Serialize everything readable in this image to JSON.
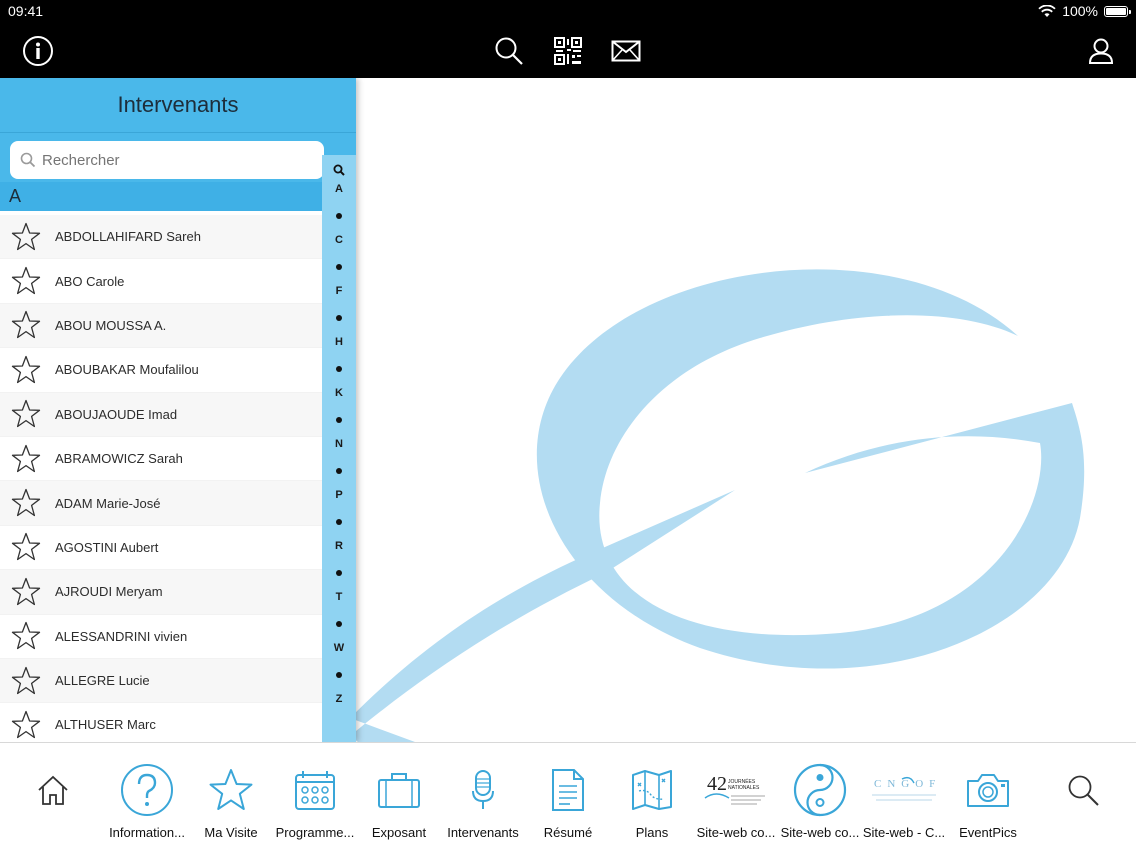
{
  "status_bar": {
    "time": "09:41",
    "battery": "100%"
  },
  "top_bar": {
    "icons": [
      "info-icon",
      "search-icon",
      "qr-code-icon",
      "mail-icon",
      "user-icon"
    ]
  },
  "panel": {
    "title": "Intervenants",
    "search_placeholder": "Rechercher",
    "section_letter": "A",
    "speakers": [
      "ABDOLLAHIFARD Sareh",
      "ABO Carole",
      "ABOU MOUSSA A.",
      "ABOUBAKAR Moufalilou",
      "ABOUJAOUDE Imad",
      "ABRAMOWICZ Sarah",
      "ADAM Marie-José",
      "AGOSTINI Aubert",
      "AJROUDI Meryam",
      "ALESSANDRINI vivien",
      "ALLEGRE Lucie",
      "ALTHUSER Marc"
    ],
    "index_letters": [
      "A",
      "C",
      "F",
      "H",
      "K",
      "N",
      "P",
      "R",
      "T",
      "W",
      "Z"
    ]
  },
  "tabbar": {
    "tabs": [
      {
        "label": "",
        "icon": "home-icon"
      },
      {
        "label": "Information...",
        "icon": "question-icon"
      },
      {
        "label": "Ma Visite",
        "icon": "star-icon"
      },
      {
        "label": "Programme...",
        "icon": "calendar-icon"
      },
      {
        "label": "Exposant",
        "icon": "briefcase-icon"
      },
      {
        "label": "Intervenants",
        "icon": "microphone-icon"
      },
      {
        "label": "Résumé",
        "icon": "document-icon"
      },
      {
        "label": "Plans",
        "icon": "map-icon"
      },
      {
        "label": "Site-web co...",
        "icon": "journees-logo-icon"
      },
      {
        "label": "Site-web co...",
        "icon": "yin-yang-icon"
      },
      {
        "label": "Site-web - C...",
        "icon": "cngof-logo-icon"
      },
      {
        "label": "EventPics",
        "icon": "camera-icon"
      },
      {
        "label": "",
        "icon": "search-icon"
      }
    ],
    "logo_text": {
      "journees_number": "42",
      "journees_word": "JOURNÉES NATIONALES",
      "cngof": "CNGOF"
    }
  },
  "colors": {
    "accent": "#4ab8ea",
    "index_bar": "#8fd3f2",
    "logo": "#b3dcf2",
    "icon_blue": "#3aa6d8"
  }
}
